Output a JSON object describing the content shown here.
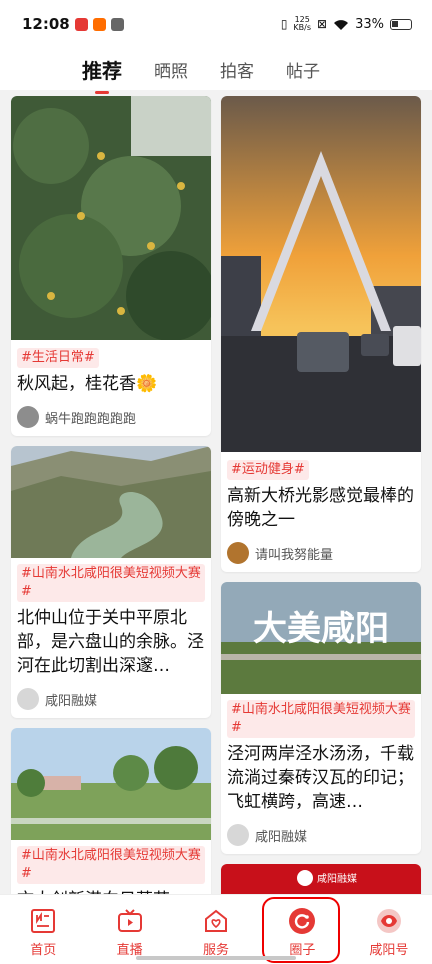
{
  "status_bar": {
    "time": "12:08",
    "speed_value": "125",
    "speed_unit": "KB/s",
    "battery": "33%"
  },
  "tabs": [
    {
      "label": "推荐",
      "active": true
    },
    {
      "label": "晒照",
      "active": false
    },
    {
      "label": "拍客",
      "active": false
    },
    {
      "label": "帖子",
      "active": false
    }
  ],
  "feed": {
    "left": [
      {
        "topic": "#生活日常#",
        "title": "秋风起，桂花香🌼",
        "author": "蜗牛跑跑跑跑跑"
      },
      {
        "topic": "#山南水北咸阳很美短视频大赛#",
        "title": "北仲山位于关中平原北部，是六盘山的余脉。泾河在此切割出深邃…",
        "author": "咸阳融媒"
      },
      {
        "topic": "#山南水北咸阳很美短视频大赛#",
        "title": "文大创新港向日葵花",
        "author": ""
      }
    ],
    "right": [
      {
        "topic": "#运动健身#",
        "title": "高新大桥光影感觉最棒的傍晚之一",
        "author": "请叫我努能量"
      },
      {
        "topic": "#山南水北咸阳很美短视频大赛#",
        "title": "泾河两岸泾水汤汤，千载流淌过秦砖汉瓦的印记；飞虹横跨，高速…",
        "author": "咸阳融媒",
        "image_text": "大美咸阳"
      },
      {
        "topic": "",
        "title": "",
        "author": "",
        "image_text": "咸阳融媒"
      }
    ]
  },
  "bottom_nav": [
    {
      "label": "首页",
      "icon": "news-icon"
    },
    {
      "label": "直播",
      "icon": "tv-icon"
    },
    {
      "label": "服务",
      "icon": "service-icon"
    },
    {
      "label": "圈子",
      "icon": "circle-icon",
      "active": true
    },
    {
      "label": "咸阳号",
      "icon": "xianyang-icon"
    }
  ],
  "colors": {
    "accent": "#e53935",
    "topic_bg": "#fde9e9"
  }
}
